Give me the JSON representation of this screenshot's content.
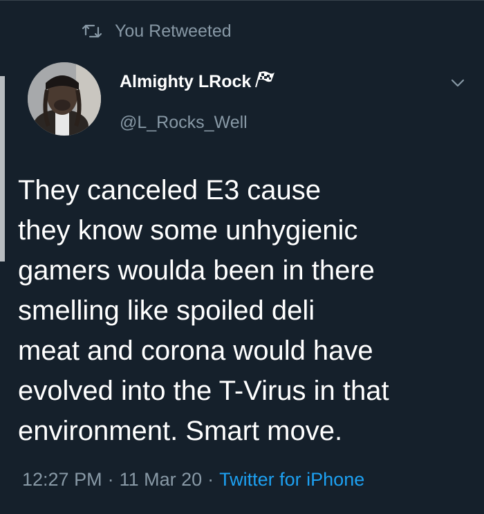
{
  "retweet": {
    "icon": "retweet-icon",
    "label": "You Retweeted"
  },
  "author": {
    "display_name": "Almighty LRock",
    "badge_icon": "checkered-flag-icon",
    "handle": "@L_Rocks_Well"
  },
  "menu": {
    "icon": "chevron-down-icon"
  },
  "tweet": {
    "text": "They canceled E3 cause\nthey know some unhygienic\ngamers woulda been in there\nsmelling like spoiled deli\nmeat and corona would have\nevolved into the T-Virus in that\nenvironment. Smart move."
  },
  "meta": {
    "time": "12:27 PM",
    "separator": "·",
    "date": "11 Mar 20",
    "source": "Twitter for iPhone"
  },
  "colors": {
    "background": "#15202b",
    "primary_text": "#ffffff",
    "secondary_text": "#8899a6",
    "link": "#1da1f2"
  }
}
